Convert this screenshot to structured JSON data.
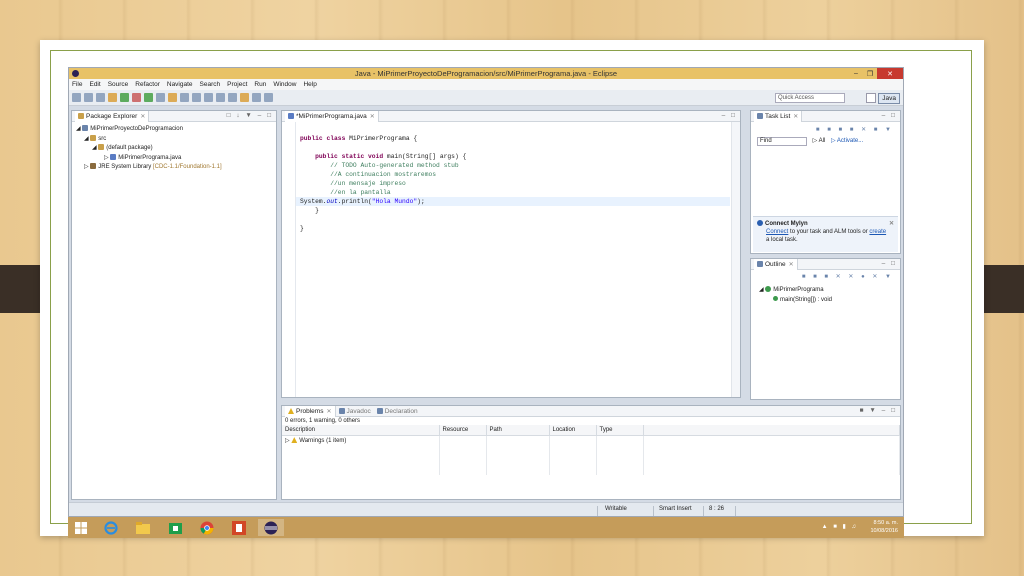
{
  "window": {
    "title": "Java - MiPrimerProyectoDeProgramacion/src/MiPrimerPrograma.java - Eclipse"
  },
  "menu": [
    "File",
    "Edit",
    "Source",
    "Refactor",
    "Navigate",
    "Search",
    "Project",
    "Run",
    "Window",
    "Help"
  ],
  "toolbar": {
    "quick_access_placeholder": "Quick Access",
    "perspective": "Java"
  },
  "package_explorer": {
    "title": "Package Explorer",
    "project": "MiPrimerProyectoDeProgramacion",
    "src": "src",
    "package": "(default package)",
    "file": "MiPrimerPrograma.java",
    "library": "JRE System Library",
    "library_detail": "[CDC-1.1/Foundation-1.1]"
  },
  "editor": {
    "tab": "*MiPrimerPrograma.java",
    "lines": {
      "l1_kw": "public class",
      "l1_rest": " MiPrimerPrograma {",
      "l2_kw": "public static void",
      "l2_rest": " main(String[] args) {",
      "l3": "// TODO Auto-generated method stub",
      "l4": "//A continuacion mostraremos",
      "l5": "//un mensaje impreso",
      "l6": "//en la pantalla",
      "l7_a": "System.",
      "l7_out": "out",
      "l7_b": ".println(",
      "l7_str": "\"Hola Mundo\"",
      "l7_c": ");",
      "l8": "}",
      "l9": "}"
    }
  },
  "task_list": {
    "title": "Task List",
    "find_placeholder": "Find",
    "all": "All",
    "activate": "Activate...",
    "mylyn_title": "Connect Mylyn",
    "mylyn_connect": "Connect",
    "mylyn_text1": " to your task and ALM tools or ",
    "mylyn_create": "create",
    "mylyn_text2": "a local task."
  },
  "outline": {
    "title": "Outline",
    "class": "MiPrimerPrograma",
    "method": "main(String[]) : void"
  },
  "problems": {
    "tabs": [
      "Problems",
      "Javadoc",
      "Declaration"
    ],
    "summary": "0 errors, 1 warning, 0 others",
    "columns": [
      "Description",
      "Resource",
      "Path",
      "Location",
      "Type"
    ],
    "row": "Warnings (1 item)"
  },
  "status": {
    "writable": "Writable",
    "insert": "Smart Insert",
    "position": "8 : 26"
  },
  "clock": {
    "time": "8:50 a. m.",
    "date": "10/08/2016"
  }
}
